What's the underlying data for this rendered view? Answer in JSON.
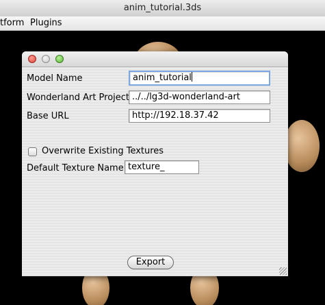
{
  "window": {
    "title": "anim_tutorial.3ds"
  },
  "menubar": {
    "items": [
      "tform",
      "Plugins"
    ]
  },
  "dialog": {
    "model_name_label": "Model Name",
    "model_name_value": "anim_tutorial",
    "art_project_label": "Wonderland Art Project",
    "art_project_value": "../../lg3d-wonderland-art",
    "base_url_label": "Base URL",
    "base_url_value": "http://192.18.37.42",
    "overwrite_label": "Overwrite Existing Textures",
    "overwrite_checked": false,
    "texture_name_label": "Default Texture Name",
    "texture_name_value": "texture_",
    "export_label": "Export"
  },
  "colors": {
    "close": "#e0443a",
    "minimize": "#c8c8c8",
    "zoom": "#5bb83a",
    "focus_ring": "#7aa7e0"
  }
}
